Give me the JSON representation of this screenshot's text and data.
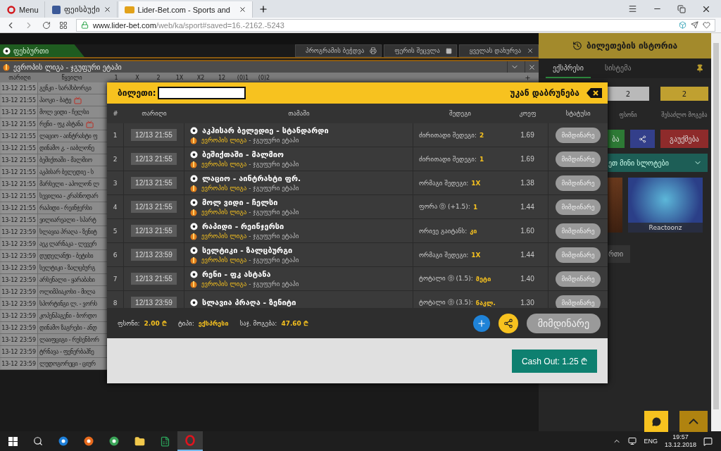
{
  "browser": {
    "tabs": [
      {
        "kind": "menu",
        "label": "Menu",
        "selected": false
      },
      {
        "kind": "social",
        "label": "ფეისბუქი",
        "selected": false
      },
      {
        "kind": "site",
        "label": "Lider-Bet.com - Sports and",
        "selected": true
      }
    ],
    "url_host": "www.lider-bet.com",
    "url_path": "/web/ka/sport#saved=16.-2162.-5243"
  },
  "sport_bar": {
    "sport": "ფეხბურთი",
    "actions": [
      {
        "kind": "print",
        "label": "პროგრამის ბეჭდვა"
      },
      {
        "kind": "color",
        "label": "ფერის შეცვლა"
      },
      {
        "kind": "close",
        "label": "ყველას დახურვა"
      }
    ]
  },
  "league_header": {
    "title": "ევროპის ლიგა - ჯგუფური ეტაპი"
  },
  "table": {
    "columns": [
      "თარიღი",
      "წყვილი"
    ],
    "odds_columns": [
      "1",
      "X",
      "2",
      "1X",
      "X2",
      "12",
      "(0)1",
      "(0)2"
    ],
    "rows": [
      {
        "date": "13-12 21:55",
        "match": "გენკი - სარპსბორგი",
        "tv": false
      },
      {
        "date": "13-12 21:55",
        "match": "პაოკი - ბატე",
        "tv": true
      },
      {
        "date": "13-12 21:55",
        "match": "მოლ ვიდი - ჩელსი",
        "tv": false
      },
      {
        "date": "13-12 21:55",
        "match": "რენი - ფკ ასტანა",
        "tv": true
      },
      {
        "date": "13-12 21:55",
        "match": "ლაციო - აინტრახტი ფ",
        "tv": false
      },
      {
        "date": "13-12 21:55",
        "match": "დინამო კ. - იაბლონე",
        "tv": false
      },
      {
        "date": "13-12 21:55",
        "match": "ბეშიქთაში - მალმიო",
        "tv": false
      },
      {
        "date": "13-12 21:55",
        "match": "აკჰისარ ბელედიე - ს",
        "tv": false
      },
      {
        "date": "13-12 21:55",
        "match": "მარსელი - აპოლონ ლ",
        "tv": false
      },
      {
        "date": "13-12 21:55",
        "match": "სევილია - კრასნოდარ",
        "tv": false
      },
      {
        "date": "13-12 21:55",
        "match": "რაპიდი - რეინჯერსი",
        "tv": false
      },
      {
        "date": "13-12 21:55",
        "match": "ვილიარეალი - სპარტ",
        "tv": false
      },
      {
        "date": "13-12 23:59",
        "match": "სლავია პრაღა - ზენიტ",
        "tv": false
      },
      {
        "date": "13-12 23:59",
        "match": "აეკ ლარნაკა - ლევერ",
        "tv": false
      },
      {
        "date": "13-12 23:59",
        "match": "დუდელანჟი - ბეტისი",
        "tv": false
      },
      {
        "date": "13-12 23:59",
        "match": "სელტიკი - ზალცბურგ",
        "tv": false
      },
      {
        "date": "13-12 23:59",
        "match": "არსენალი - ყარაბახი",
        "tv": false
      },
      {
        "date": "13-12 23:59",
        "match": "ოლიმპიაკოსი - მილა",
        "tv": false
      },
      {
        "date": "13-12 23:59",
        "match": "სპორტინგი ლ. - ვორს",
        "tv": false
      },
      {
        "date": "13-12 23:59",
        "match": "კოპენჰაგენი - ბორდო",
        "tv": false
      },
      {
        "date": "13-12 23:59",
        "match": "დინამო ზაგრები - ანდ",
        "tv": false
      },
      {
        "date": "13-12 23:59",
        "match": "ლაიფციგი - რუსენბორ",
        "tv": false
      },
      {
        "date": "13-12 23:59",
        "match": "ტრნავა - ფენერბაჰჩე",
        "tv": false
      },
      {
        "date": "13-12 23:59",
        "match": "ლუდოგორეცი - ციურ",
        "tv": false
      }
    ]
  },
  "ticket_panel": {
    "title": "ბილეთების ისტორია",
    "tabs": [
      {
        "label": "ექსპრესი",
        "selected": true
      },
      {
        "label": "სისტემა",
        "selected": false
      }
    ],
    "stake_value": "2",
    "win_value": "2",
    "stake_label": "ფსონი",
    "win_label": "შესაძლო მოგება",
    "confirm_button": "ბა",
    "cancel_button": "გაუქმება",
    "slots_title": "ეთ მინი სლოტები",
    "game_label": "Reactoonz",
    "bottom_tab": "რთი"
  },
  "modal": {
    "title": "ბილეთი:",
    "back": "უკან დაბრუნება",
    "columns": [
      "#",
      "თარიღი",
      "თამაში",
      "შედეგი",
      "კოეფ",
      "სტატუსი"
    ],
    "rows": [
      {
        "num": "1",
        "date": "12/13 21:55",
        "match": "აკჰისარ ბელედიე - სტანდარდი",
        "league": "ევროპის ლიგა",
        "stage": "- ჯგუფური ეტაპი",
        "market": "ძირითადი შედეგი:",
        "pick": "2",
        "odds": "1.69",
        "status": "მიმდინარე"
      },
      {
        "num": "2",
        "date": "12/13 21:55",
        "match": "ბეშიქთაში - მალმიო",
        "league": "ევროპის ლიგა",
        "stage": "- ჯგუფური ეტაპი",
        "market": "ძირითადი შედეგი:",
        "pick": "1",
        "odds": "1.69",
        "status": "მიმდინარე"
      },
      {
        "num": "3",
        "date": "12/13 21:55",
        "match": "ლაციო - აინტრახტი ფრ.",
        "league": "ევროპის ლიგა",
        "stage": "- ჯგუფური ეტაპი",
        "market": "ორმაგი შედეგი:",
        "pick": "1X",
        "odds": "1.38",
        "status": "მიმდინარე"
      },
      {
        "num": "4",
        "date": "12/13 21:55",
        "match": "მოლ ვიდი - ჩელსი",
        "league": "ევროპის ლიგა",
        "stage": "- ჯგუფური ეტაპი",
        "market": "ფორა ⓞ (+1.5):",
        "pick": "1",
        "odds": "1.44",
        "status": "მიმდინარე"
      },
      {
        "num": "5",
        "date": "12/13 21:55",
        "match": "რაპიდი - რეინჯერსი",
        "league": "ევროპის ლიგა",
        "stage": "- ჯგუფური ეტაპი",
        "market": "ორივე გაიტანს:",
        "pick": "კი",
        "odds": "1.60",
        "status": "მიმდინარე"
      },
      {
        "num": "6",
        "date": "12/13 23:59",
        "match": "სელტიკი - ზალცბურგი",
        "league": "ევროპის ლიგა",
        "stage": "- ჯგუფური ეტაპი",
        "market": "ორმაგი შედეგი:",
        "pick": "1X",
        "odds": "1.44",
        "status": "მიმდინარე"
      },
      {
        "num": "7",
        "date": "12/13 21:55",
        "match": "რენი - ფკ ასტანა",
        "league": "ევროპის ლიგა",
        "stage": "- ჯგუფური ეტაპი",
        "market": "ტოტალი ⓞ (1.5):",
        "pick": "მეტი",
        "odds": "1.40",
        "status": "მიმდინარე"
      },
      {
        "num": "8",
        "date": "12/13 23:59",
        "match": "სლავია პრაღა - ზენიტი",
        "market": "ტოტალი ⓞ (3.5):",
        "pick": "ნაკლ.",
        "odds": "1.30",
        "status": "მიმდინარე"
      }
    ],
    "footer": {
      "stake_label": "ფსონი:",
      "stake": "2.00 ₾",
      "type_label": "ტიპი:",
      "type": "ექსპრესი",
      "win_label": "საჯ. მოგება:",
      "win": "47.60 ₾",
      "status_button": "მიმდინარე"
    },
    "cashout": "Cash Out: 1.25 ₾"
  },
  "taskbar": {
    "language": "ENG",
    "time": "19:57",
    "date": "13.12.2018"
  }
}
